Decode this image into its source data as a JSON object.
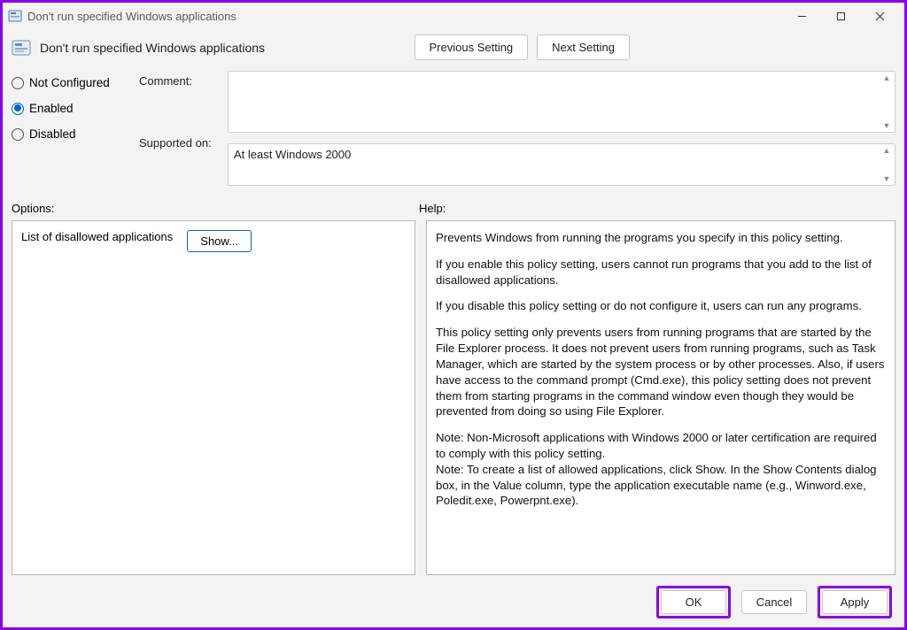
{
  "window": {
    "title": "Don't run specified Windows applications"
  },
  "header": {
    "policy_title": "Don't run specified Windows applications",
    "prev_button": "Previous Setting",
    "next_button": "Next Setting"
  },
  "state": {
    "not_configured": "Not Configured",
    "enabled": "Enabled",
    "disabled": "Disabled",
    "selected": "enabled"
  },
  "fields": {
    "comment_label": "Comment:",
    "comment_value": "",
    "supported_label": "Supported on:",
    "supported_value": "At least Windows 2000"
  },
  "sections": {
    "options_label": "Options:",
    "help_label": "Help:"
  },
  "options": {
    "list_label": "List of disallowed applications",
    "show_button": "Show..."
  },
  "help": {
    "p1": "Prevents Windows from running the programs you specify in this policy setting.",
    "p2": "If you enable this policy setting, users cannot run programs that you add to the list of disallowed applications.",
    "p3": "If you disable this policy setting or do not configure it, users can run any programs.",
    "p4": "This policy setting only prevents users from running programs that are started by the File Explorer process. It does not prevent users from running programs, such as Task Manager, which are started by the system process or by other processes.  Also, if users have access to the command prompt (Cmd.exe), this policy setting does not prevent them from starting programs in the command window even though they would be prevented from doing so using File Explorer.",
    "p5": "Note: Non-Microsoft applications with Windows 2000 or later certification are required to comply with this policy setting.",
    "p6": "Note: To create a list of allowed applications, click Show.  In the Show Contents dialog box, in the Value column, type the application executable name (e.g., Winword.exe, Poledit.exe, Powerpnt.exe)."
  },
  "footer": {
    "ok": "OK",
    "cancel": "Cancel",
    "apply": "Apply"
  }
}
